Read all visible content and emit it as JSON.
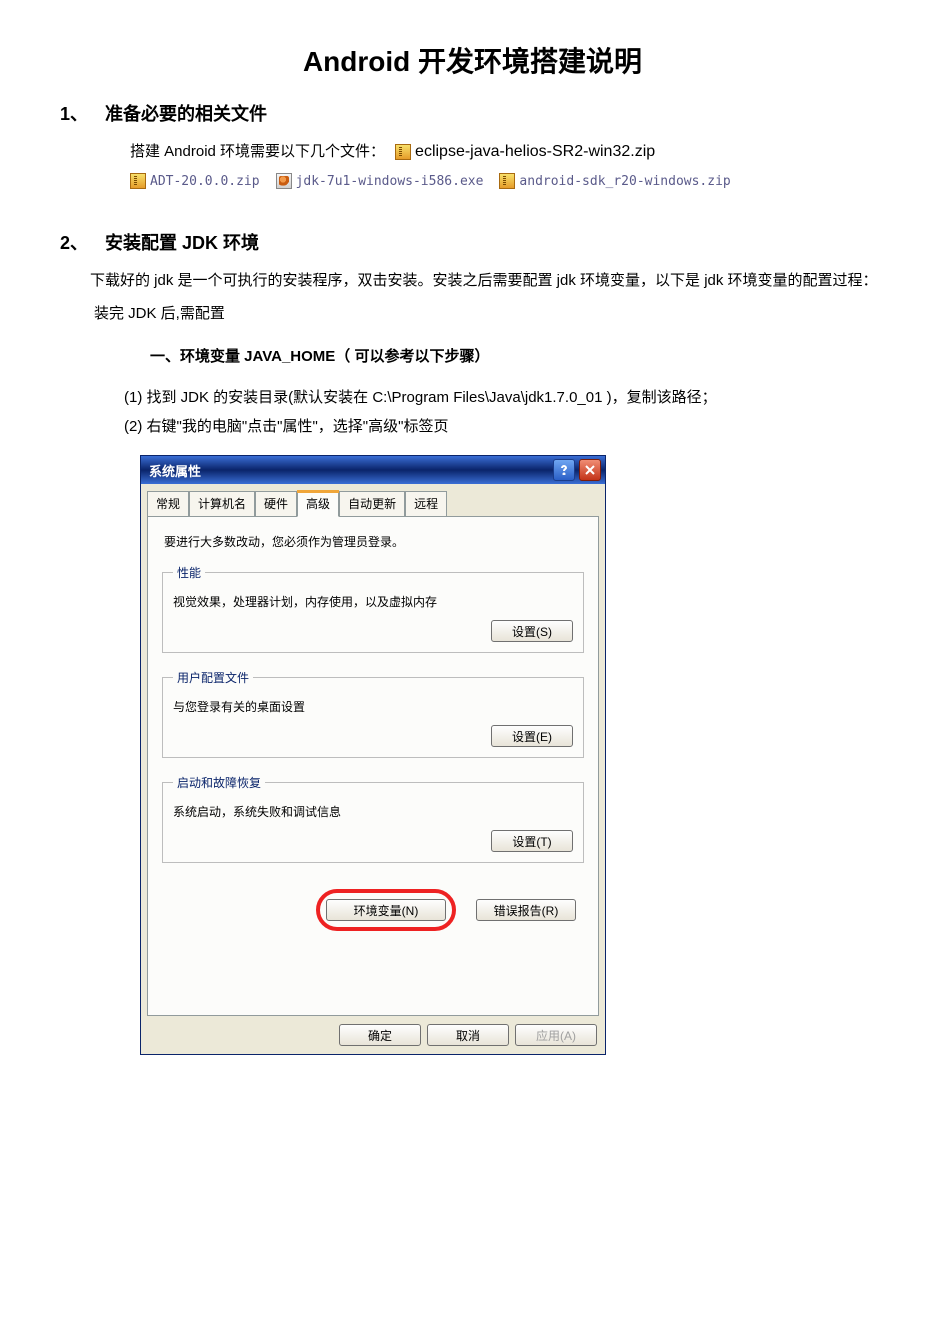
{
  "title": "Android 开发环境搭建说明",
  "section1": {
    "num": "1、",
    "heading": "准备必要的相关文件",
    "line1_prefix": "搭建 Android 环境需要以下几个文件：",
    "files": [
      {
        "name": "eclipse-java-helios-SR2-win32.zip",
        "iconClass": "zip-icon"
      },
      {
        "name": "ADT-20.0.0.zip",
        "iconClass": "zip-icon"
      },
      {
        "name": "jdk-7u1-windows-i586.exe",
        "iconClass": "exe-icon"
      },
      {
        "name": "android-sdk_r20-windows.zip",
        "iconClass": "zip-icon"
      }
    ]
  },
  "section2": {
    "num": "2、",
    "heading": "安装配置 JDK 环境",
    "p1": "下载好的 jdk 是一个可执行的安装程序，双击安装。安装之后需要配置 jdk 环境变量，以下是 jdk 环境变量的配置过程：",
    "p2": "装完 JDK 后,需配置",
    "sub_heading": "一、环境变量 JAVA_HOME（  可以参考以下步骤）",
    "step1": "(1)  找到 JDK 的安装目录(默认安装在 C:\\Program Files\\Java\\jdk1.7.0_01 )，复制该路径；",
    "step2": "(2)  右键\"我的电脑\"点击\"属性\"，选择\"高级\"标签页"
  },
  "dialog": {
    "title": "系统属性",
    "tabs": [
      "常规",
      "计算机名",
      "硬件",
      "高级",
      "自动更新",
      "远程"
    ],
    "activeTab": 3,
    "admin_hint": "要进行大多数改动，您必须作为管理员登录。",
    "groups": {
      "perf": {
        "legend": "性能",
        "text": "视觉效果，处理器计划，内存使用，以及虚拟内存",
        "button": "设置(S)"
      },
      "profile": {
        "legend": "用户配置文件",
        "text": "与您登录有关的桌面设置",
        "button": "设置(E)"
      },
      "startup": {
        "legend": "启动和故障恢复",
        "text": "系统启动，系统失败和调试信息",
        "button": "设置(T)"
      }
    },
    "env_button": "环境变量(N)",
    "err_button": "错误报告(R)",
    "ok": "确定",
    "cancel": "取消",
    "apply": "应用(A)"
  }
}
